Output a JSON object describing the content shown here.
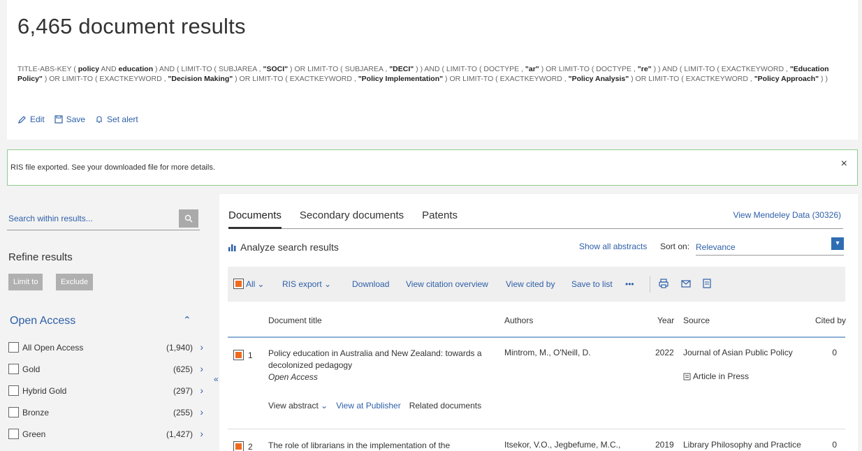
{
  "header": {
    "results_title": "6,465 document results",
    "query_parts": [
      {
        "t": "TITLE-ABS-KEY ( ",
        "b": false
      },
      {
        "t": "policy",
        "b": true
      },
      {
        "t": " AND ",
        "b": false
      },
      {
        "t": "education",
        "b": true
      },
      {
        "t": " ) AND ( LIMIT-TO ( SUBJAREA , ",
        "b": false
      },
      {
        "t": "\"SOCI\"",
        "b": true
      },
      {
        "t": " ) OR LIMIT-TO ( SUBJAREA , ",
        "b": false
      },
      {
        "t": "\"DECI\"",
        "b": true
      },
      {
        "t": " ) ) AND ( LIMIT-TO ( DOCTYPE , ",
        "b": false
      },
      {
        "t": "\"ar\"",
        "b": true
      },
      {
        "t": " ) OR LIMIT-TO ( DOCTYPE , ",
        "b": false
      },
      {
        "t": "\"re\"",
        "b": true
      },
      {
        "t": " ) ) AND ( LIMIT-TO ( EXACTKEYWORD , ",
        "b": false
      },
      {
        "t": "\"Education Policy\"",
        "b": true
      },
      {
        "t": " ) OR LIMIT-TO ( EXACTKEYWORD , ",
        "b": false
      },
      {
        "t": "\"Decision Making\"",
        "b": true
      },
      {
        "t": " ) OR LIMIT-TO ( EXACTKEYWORD , ",
        "b": false
      },
      {
        "t": "\"Policy Implementation\"",
        "b": true
      },
      {
        "t": " ) OR LIMIT-TO ( EXACTKEYWORD , ",
        "b": false
      },
      {
        "t": "\"Policy Analysis\"",
        "b": true
      },
      {
        "t": " ) OR LIMIT-TO ( EXACTKEYWORD , ",
        "b": false
      },
      {
        "t": "\"Policy Approach\"",
        "b": true
      },
      {
        "t": " ) )",
        "b": false
      }
    ],
    "actions": {
      "edit": "Edit",
      "save": "Save",
      "alert": "Set alert"
    }
  },
  "notice": {
    "text": "RIS file exported. See your downloaded file for more details.",
    "close": "×"
  },
  "sidebar": {
    "search_placeholder": "Search within results...",
    "refine_title": "Refine results",
    "limit_to": "Limit to",
    "exclude": "Exclude",
    "facet_title": "Open Access",
    "facets": [
      {
        "label": "All Open Access",
        "count": "(1,940)"
      },
      {
        "label": "Gold",
        "count": "(625)"
      },
      {
        "label": "Hybrid Gold",
        "count": "(297)"
      },
      {
        "label": "Bronze",
        "count": "(255)"
      },
      {
        "label": "Green",
        "count": "(1,427)"
      }
    ]
  },
  "main": {
    "tabs": [
      "Documents",
      "Secondary documents",
      "Patents"
    ],
    "mendeley": "View Mendeley Data (30326)",
    "analyze": "Analyze search results",
    "show_abstracts": "Show all abstracts",
    "sort_label": "Sort on:",
    "sort_value": "Relevance",
    "toolbar": {
      "all": "All",
      "ris_export": "RIS export",
      "download": "Download",
      "citation_overview": "View citation overview",
      "cited_by": "View cited by",
      "save_to_list": "Save to list",
      "more": "•••"
    },
    "columns": {
      "title": "Document title",
      "authors": "Authors",
      "year": "Year",
      "source": "Source",
      "cited": "Cited by"
    },
    "rows": [
      {
        "num": "1",
        "title": "Policy education in Australia and New Zealand: towards a decolonized pedagogy",
        "oa": "Open Access",
        "authors": "Mintrom, M., O'Neill, D.",
        "year": "2022",
        "source": "Journal of Asian Public Policy",
        "status": "Article in Press",
        "cited": "0",
        "view_abstract": "View abstract",
        "view_publisher": "View at Publisher",
        "related": "Related documents"
      },
      {
        "num": "2",
        "title": "The role of librarians in the implementation of the",
        "authors": "Itsekor, V.O., Jegbefume, M.C.,",
        "year": "2019",
        "source": "Library Philosophy and Practice",
        "cited": "0"
      }
    ]
  },
  "colors": {
    "link": "#2e5fa8",
    "accent_orange": "#f06a1e",
    "notice_border": "#8fcc8f"
  }
}
